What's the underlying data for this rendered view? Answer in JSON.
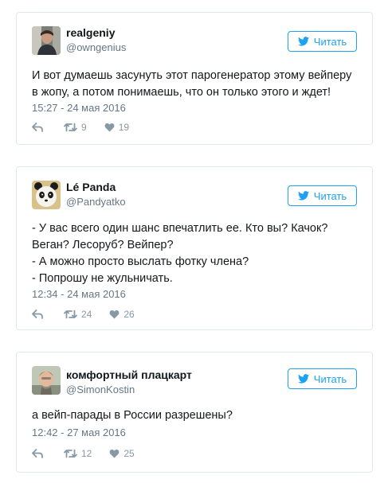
{
  "colors": {
    "accent": "#1da1f2",
    "name": "#14171a",
    "meta": "#657786",
    "icon": "#8899a6",
    "border": "#e1e8ed"
  },
  "tweets": [
    {
      "author": "realgeniy",
      "handle": "@owngenius",
      "follow_label": "Читать",
      "lines": [
        "И вот думаешь засунуть этот парогенератор этому вейперу",
        "в жопу, а потом понимаешь, что он только этого и ждет!"
      ],
      "timestamp": "15:27 - 24 мая 2016",
      "retweets": "9",
      "likes": "19",
      "avatar_icon": "avatar-photo-icon"
    },
    {
      "author": "Lé Panda",
      "handle": "@Pandyatko",
      "follow_label": "Читать",
      "lines": [
        "- У вас всего один шанс впечатлить ее. Кто вы? Качок?",
        "Веган? Лесоруб? Вейпер?",
        "- А можно просто выслать фотку члена?",
        "- Попрошу не жульничать."
      ],
      "timestamp": "12:34 - 24 мая 2016",
      "retweets": "24",
      "likes": "26",
      "avatar_icon": "panda-avatar-icon"
    },
    {
      "author": "комфортный плацкарт",
      "handle": "@SimonKostin",
      "follow_label": "Читать",
      "lines": [
        "а вейп-парады в России разрешены?"
      ],
      "timestamp": "12:42 - 27 мая 2016",
      "retweets": "12",
      "likes": "25",
      "avatar_icon": "avatar-photo-icon"
    }
  ]
}
